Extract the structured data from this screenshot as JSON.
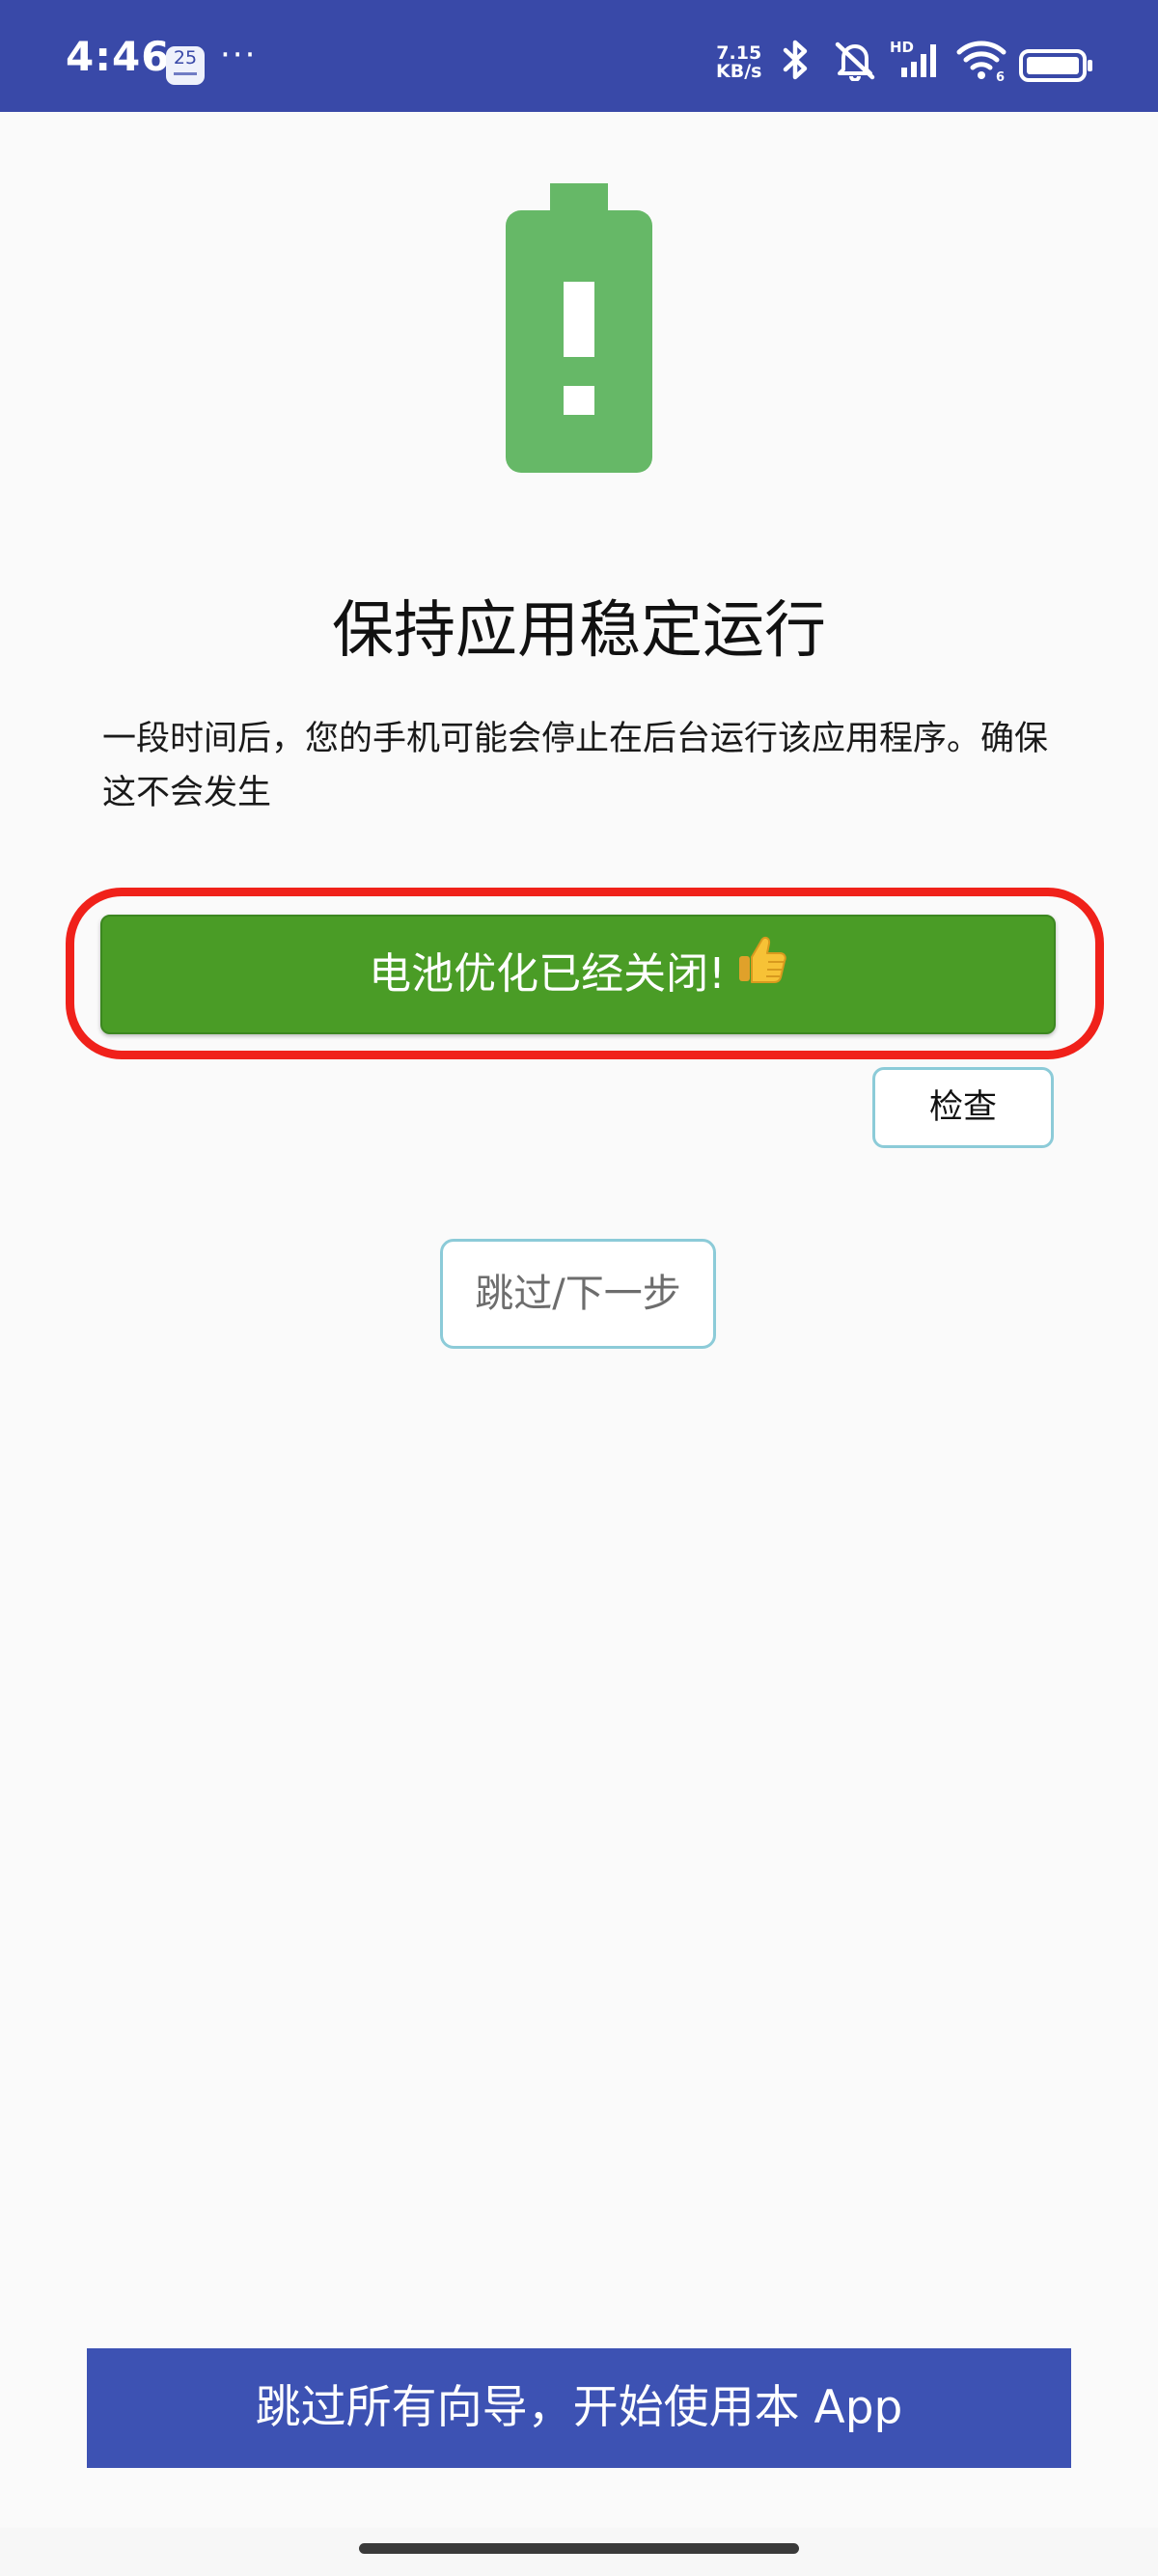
{
  "status_bar": {
    "time": "4:46",
    "calendar_day": "25",
    "more_indicator": "···",
    "net_speed_value": "7.15",
    "net_speed_unit": "KB/s",
    "signal_label": "HD",
    "wifi_label": "6",
    "icons": [
      "calendar-icon",
      "bluetooth-icon",
      "silent-mode-icon",
      "signal-icon",
      "wifi-icon",
      "battery-status-icon"
    ]
  },
  "main": {
    "illustration_icon": "battery-alert-icon",
    "title": "保持应用稳定运行",
    "description": "一段时间后，您的手机可能会停止在后台运行该应用程序。确保这不会发生",
    "battery_optimization_button": "电池优化已经关闭!",
    "battery_optimization_icon": "thumbs-up-icon",
    "check_button": "检查",
    "skip_next_button": "跳过/下一步"
  },
  "footer": {
    "skip_all_button": "跳过所有向导，开始使用本 App"
  },
  "colors": {
    "status_bar": "#3949a8",
    "battery_illustration": "#66b867",
    "success_button": "#4a9c26",
    "highlight_ring": "#f0211a",
    "outline_button_border": "#8ccbd8",
    "footer_button": "#3d52b3"
  }
}
